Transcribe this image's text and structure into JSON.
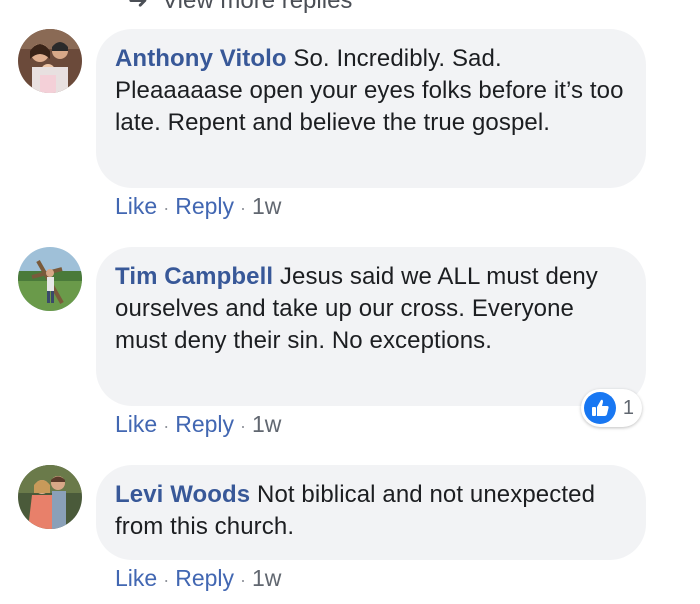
{
  "view_more": {
    "label": "View more replies"
  },
  "comments": [
    {
      "author": "Anthony Vitolo",
      "text": " So. Incredibly. Sad. Pleaaaaase open your eyes folks before it’s too late. Repent and believe the true gospel.",
      "like_label": "Like",
      "reply_label": "Reply",
      "time": "1w"
    },
    {
      "author": "Tim Campbell",
      "text": " Jesus said we ALL must deny ourselves and take up our cross. Everyone must deny their sin. No exceptions.",
      "like_label": "Like",
      "reply_label": "Reply",
      "time": "1w",
      "reaction_count": "1",
      "reaction_icon": "thumbs-up-icon"
    },
    {
      "author": "Levi Woods",
      "text": " Not biblical and not unexpected from this church.",
      "like_label": "Like",
      "reply_label": "Reply",
      "time": "1w"
    }
  ],
  "colors": {
    "author": "#385898",
    "link": "#4267b2",
    "bubble": "#f2f3f5",
    "like_blue": "#1877f2"
  }
}
